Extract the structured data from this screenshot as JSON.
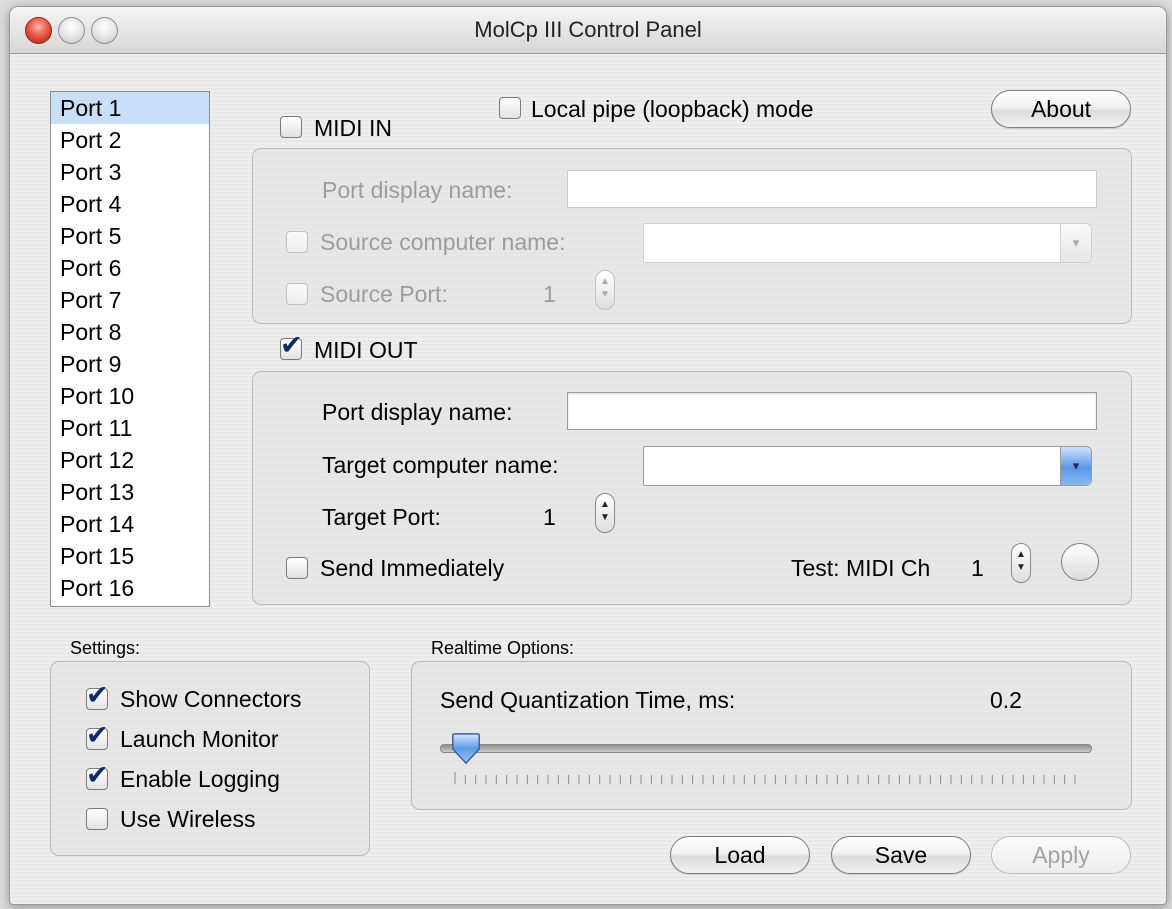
{
  "window": {
    "title": "MolCp III Control Panel"
  },
  "ports": [
    "Port 1",
    "Port 2",
    "Port 3",
    "Port 4",
    "Port 5",
    "Port 6",
    "Port 7",
    "Port 8",
    "Port 9",
    "Port 10",
    "Port 11",
    "Port 12",
    "Port 13",
    "Port 14",
    "Port 15",
    "Port 16"
  ],
  "selected_port": "Port 1",
  "top": {
    "loopback_label": "Local pipe (loopback) mode",
    "loopback_checked": false,
    "about_label": "About"
  },
  "midi_in": {
    "label": "MIDI IN",
    "checked": false,
    "port_display_name_label": "Port display name:",
    "port_display_name_value": "",
    "source_computer_label": "Source computer name:",
    "source_computer_value": "",
    "source_port_label": "Source Port:",
    "source_port_value": "1"
  },
  "midi_out": {
    "label": "MIDI OUT",
    "checked": true,
    "port_display_name_label": "Port display name:",
    "port_display_name_value": "",
    "target_computer_label": "Target computer name:",
    "target_computer_value": "",
    "target_port_label": "Target Port:",
    "target_port_value": "1",
    "send_immediately_label": "Send Immediately",
    "send_immediately_checked": false,
    "test_label": "Test: MIDI Ch",
    "test_channel": "1"
  },
  "settings": {
    "label": "Settings:",
    "items": [
      {
        "label": "Show Connectors",
        "checked": true
      },
      {
        "label": "Launch Monitor",
        "checked": true
      },
      {
        "label": "Enable Logging",
        "checked": true
      },
      {
        "label": "Use Wireless",
        "checked": false
      }
    ]
  },
  "realtime": {
    "label": "Realtime Options:",
    "quantization_label": "Send Quantization Time, ms:",
    "quantization_value": "0.2",
    "slider_fraction": 0.02
  },
  "buttons": {
    "load": "Load",
    "save": "Save",
    "apply": "Apply"
  },
  "colors": {
    "selection": "#c9dff7",
    "checkmark": "#0b2a66",
    "combo_accent": "#5b97e6"
  }
}
